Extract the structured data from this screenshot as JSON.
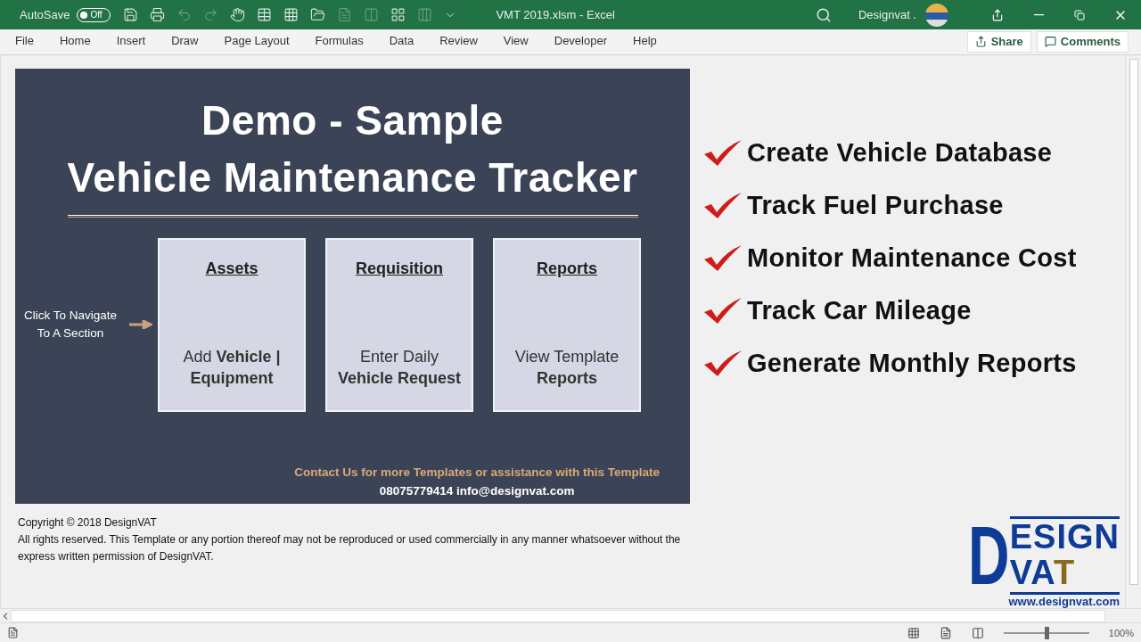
{
  "window": {
    "autosave_label": "AutoSave",
    "autosave": {
      "on": false,
      "label": "Off"
    },
    "title": "VMT 2019.xlsm  -  Excel",
    "user": "Designvat ."
  },
  "ribbon_tabs": [
    {
      "label": "File",
      "selected": false
    },
    {
      "label": "Home",
      "selected": false
    },
    {
      "label": "Insert",
      "selected": false
    },
    {
      "label": "Draw",
      "selected": false
    },
    {
      "label": "Page Layout",
      "selected": false
    },
    {
      "label": "Formulas",
      "selected": false
    },
    {
      "label": "Data",
      "selected": false
    },
    {
      "label": "Review",
      "selected": false
    },
    {
      "label": "View",
      "selected": false
    },
    {
      "label": "Developer",
      "selected": false
    },
    {
      "label": "Help",
      "selected": false
    }
  ],
  "ribbon_buttons": {
    "share": "Share",
    "comments": "Comments"
  },
  "panel": {
    "title_line_1": "Demo - Sample",
    "title_line_2": "Vehicle Maintenance Tracker",
    "hint": "Click To Navigate To A Section",
    "cards": [
      {
        "heading": "Assets",
        "body": "Add **Vehicle | Equipment**"
      },
      {
        "heading": "Requisition",
        "body": "Enter Daily **Vehicle Request**"
      },
      {
        "heading": "Reports",
        "body": "View Template **Reports**"
      }
    ],
    "contact": "Contact Us for more Templates or assistance with this Template",
    "contact_details": "08075779414  info@designvat.com"
  },
  "features": [
    "Create Vehicle Database",
    "Track Fuel Purchase",
    "Monitor Maintenance Cost",
    "Track Car Mileage",
    "Generate Monthly Reports"
  ],
  "copyright": {
    "line_1": "Copyright © 2018 DesignVAT",
    "line_2": "All rights reserved. This Template or any portion thereof may not be reproduced or used commercially in any manner whatsoever without the express written permission of DesignVAT."
  },
  "logo": {
    "initial": "D",
    "line_1": "ESIGN",
    "line_2": "VA",
    "line_2_accent": "T",
    "url": "www.designvat.com"
  },
  "status_bar": {
    "zoom": {
      "level": 0.5,
      "reading": "100%"
    }
  }
}
